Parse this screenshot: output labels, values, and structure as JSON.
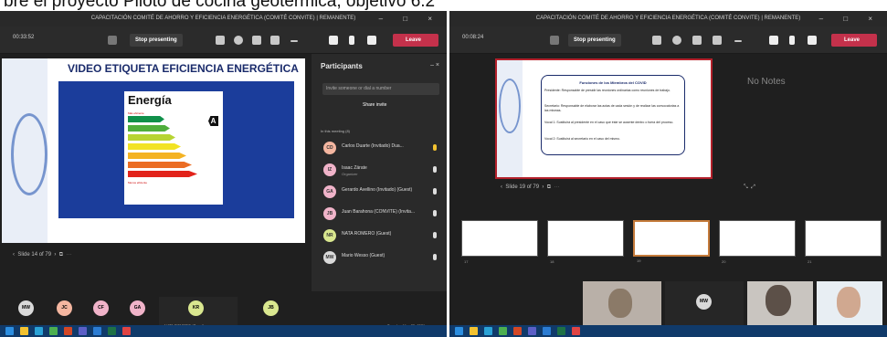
{
  "caption": "bre el proyecto Piloto de cocina geotérmica, objetivo 6.2",
  "left_window": {
    "window_title": "CAPACITACIÓN COMITÉ DE AHORRO Y EFICIENCIA ENERGÉTICA (COMITÉ CONVITE) | REMANENTE)",
    "window_controls": "– □ ×",
    "timer": "00:33:52",
    "stop_presenting": "Stop presenting",
    "leave": "Leave",
    "slide": {
      "title": "VIDEO ETIQUETA EFICIENCIA ENERGÉTICA",
      "energy_label": "Energía",
      "more_efficient": "Más eficiente",
      "less_efficient": "Menos eficiente",
      "grade": "A"
    },
    "slide_nav": "Slide 14 of 79",
    "participants": {
      "header": "Participants",
      "search_placeholder": "Invite someone or dial a number",
      "share_invite": "Share invite",
      "in_meeting": "In this meeting (8)",
      "rows": [
        {
          "initials": "CD",
          "name": "Carlos Duarte (Invitado) Dua...",
          "sub": "",
          "color": "#f4b6a0"
        },
        {
          "initials": "IZ",
          "name": "Isaac Zárate",
          "sub": "Organizer",
          "color": "#f0b3c9"
        },
        {
          "initials": "GA",
          "name": "Gerardo Avellino (Invitado) (Guest)",
          "sub": "",
          "color": "#f0b3c9"
        },
        {
          "initials": "JB",
          "name": "Juan Barahona (CONVITE) (Invita...",
          "sub": "",
          "color": "#f0b3c9"
        },
        {
          "initials": "NR",
          "name": "NATA ROMERO (Guest)",
          "sub": "",
          "color": "#d9e78f"
        },
        {
          "initials": "MW",
          "name": "Mario Wesso (Guest)",
          "sub": "",
          "color": "#d9d9d9"
        }
      ]
    },
    "gallery": [
      {
        "initials": "MW",
        "color": "#d9d9d9"
      },
      {
        "initials": "JC",
        "color": "#f4b6a0"
      },
      {
        "initials": "CF",
        "color": "#f0b3c9"
      },
      {
        "initials": "GA",
        "color": "#f0b3c9"
      }
    ],
    "tile_avatar": "KR",
    "tile_avatar_color": "#d9e78f",
    "tile_label": "NATA ROMERO (Guest)",
    "tile_avatar2": "JB",
    "tile_avatar2_color": "#d9e78f",
    "time": "Tuesday, May 25, 2021"
  },
  "right_window": {
    "window_title": "CAPACITACIÓN COMITÉ DE AHORRO Y EFICIENCIA ENERGÉTICA (COMITÉ CONVITE) | REMANENTE)",
    "window_controls": "– □ ×",
    "timer": "00:08:24",
    "stop_presenting": "Stop presenting",
    "leave": "Leave",
    "notes": "No Notes",
    "slide_nav": "Slide 19 of 79",
    "covid": {
      "title": "Funciones de los Miembros del COVID",
      "p1": "Presidente: Responsable de presidir las reuniones ordinarias como reuniones de trabajo.",
      "p2": "Secretario: Responsable de elaborar las actas de cada sesión y de realizar las convocatorias a las mismas.",
      "p3": "Vocal 1: Sustituirá al presidente en el caso que éste se ausente dentro o fuera del proceso.",
      "p4": "Vocal 2: Sustituirá al secretario en el caso del mismo."
    },
    "tile_avatar": "MW",
    "tile_avatar_color": "#d9d9d9",
    "thumb_numbers": [
      "17",
      "18",
      "19",
      "20",
      "21"
    ]
  }
}
